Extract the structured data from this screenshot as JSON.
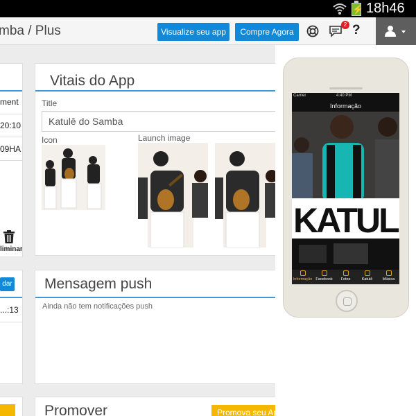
{
  "status_bar": {
    "time": "18h46"
  },
  "header": {
    "app_title": "mba / Plus",
    "visualize_label": "Visualize seu app",
    "buy_label": "Compre Agora",
    "chat_badge": "2",
    "help_label": "?"
  },
  "left_column": {
    "rows": [
      "ment",
      "20:10",
      "09HA"
    ],
    "delete_label": "liminar",
    "push_button_label": "dar",
    "push_time": "13:..."
  },
  "vitals": {
    "title": "Vitais do App",
    "title_label": "Title",
    "title_value": "Katulê do Samba",
    "icon_label": "Icon",
    "launch_label": "Launch image"
  },
  "push": {
    "title": "Mensagem push",
    "empty_text": "Ainda não tem notificações push"
  },
  "promote": {
    "title": "Promover",
    "button_label": "Promova seu Ap"
  },
  "phone": {
    "carrier": "Carrier",
    "clock": "4:40 PM",
    "nav_title": "Informação",
    "tabs": [
      "Informação",
      "Facebook",
      "Fotos",
      "Katulê",
      "Música"
    ]
  },
  "colors": {
    "accent": "#1288d6",
    "promote": "#f6b700",
    "rule": "#3a9ad9"
  }
}
